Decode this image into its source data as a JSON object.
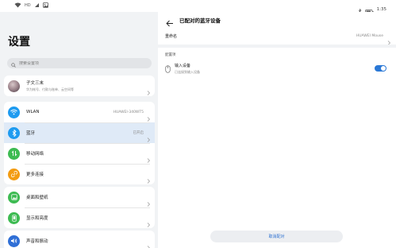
{
  "status_bar": {
    "left_icons": [
      "wifi-icon",
      "signal-icon",
      "image-icon"
    ],
    "left_text": "HD",
    "time": "1:35",
    "right_icons": [
      "bluetooth-icon",
      "battery-icon"
    ]
  },
  "left_panel": {
    "title": "设置",
    "search_placeholder": "搜索设置项",
    "profile": {
      "name": "子文三末",
      "subtitle": "华为帐号、付款与账单、云空间等"
    },
    "items": [
      {
        "label": "WLAN",
        "value": "HUAWEI-340WT5",
        "icon": "wifi-icon",
        "color": "#1e9bf0"
      },
      {
        "label": "蓝牙",
        "value": "已开启",
        "icon": "bluetooth-icon",
        "color": "#1e9bf0",
        "selected": true
      },
      {
        "label": "移动网络",
        "value": "",
        "icon": "mobile-network-icon",
        "color": "#3dbb52"
      },
      {
        "label": "更多连接",
        "value": "",
        "icon": "more-connections-icon",
        "color": "#f39c12"
      },
      {
        "label": "桌面和壁纸",
        "value": "",
        "icon": "wallpaper-icon",
        "color": "#3dbb52"
      },
      {
        "label": "显示和亮度",
        "value": "",
        "icon": "display-icon",
        "color": "#3dbb52"
      },
      {
        "label": "声音和振动",
        "value": "",
        "icon": "sound-icon",
        "color": "#2f6fd6"
      }
    ]
  },
  "right_panel": {
    "title": "已配对的蓝牙设备",
    "rename_label": "重命名",
    "device_name": "HUAWEI Mouse",
    "section_label": "配置项",
    "input_device_title": "输入设备",
    "input_device_sub": "已连接到输入设备",
    "input_toggle_on": true,
    "cancel_button": "取消配对",
    "accent_color": "#2a78d6"
  }
}
